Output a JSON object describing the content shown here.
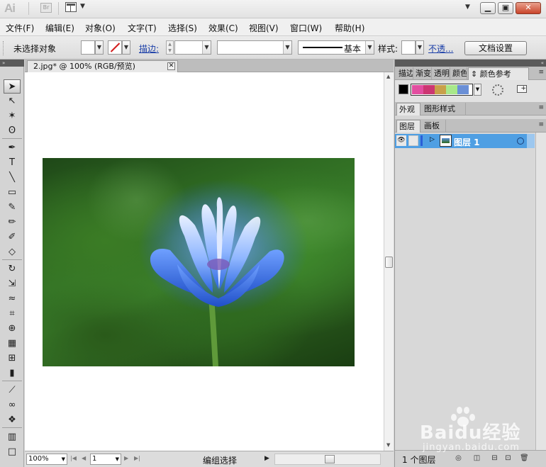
{
  "app": {
    "logo": "Ai",
    "bridge": "Br"
  },
  "colors": {
    "layer_highlight": "#4f9fe3",
    "color_guide_swatches": [
      "#e24ea0",
      "#cc3672",
      "#c8a04a",
      "#a8e88a",
      "#6a8fd6"
    ]
  },
  "menu": [
    "文件(F)",
    "编辑(E)",
    "对象(O)",
    "文字(T)",
    "选择(S)",
    "效果(C)",
    "视图(V)",
    "窗口(W)",
    "帮助(H)"
  ],
  "control_bar": {
    "selection_status": "未选择对象",
    "stroke_label": "描边:",
    "brush_label": "基本",
    "style_label": "样式:",
    "opacity_label": "不透...",
    "doc_setup_button": "文档设置"
  },
  "document": {
    "tab_title": "2.jpg* @ 100% (RGB/预览)",
    "close_icon": "close-icon"
  },
  "tools": [
    {
      "name": "selection-tool-icon",
      "glyph": "➤",
      "active": true
    },
    {
      "name": "direct-selection-tool-icon",
      "glyph": "↖"
    },
    {
      "name": "magic-wand-tool-icon",
      "glyph": "✶"
    },
    {
      "name": "lasso-tool-icon",
      "glyph": "ʘ"
    },
    {
      "name": "pen-tool-icon",
      "glyph": "✒"
    },
    {
      "name": "type-tool-icon",
      "glyph": "T"
    },
    {
      "name": "line-tool-icon",
      "glyph": "╲"
    },
    {
      "name": "rectangle-tool-icon",
      "glyph": "▭"
    },
    {
      "name": "paintbrush-tool-icon",
      "glyph": "✎"
    },
    {
      "name": "pencil-tool-icon",
      "glyph": "✏"
    },
    {
      "name": "blob-brush-tool-icon",
      "glyph": "✐"
    },
    {
      "name": "eraser-tool-icon",
      "glyph": "◇"
    },
    {
      "name": "rotate-tool-icon",
      "glyph": "↻"
    },
    {
      "name": "scale-tool-icon",
      "glyph": "⇲"
    },
    {
      "name": "warp-tool-icon",
      "glyph": "≈"
    },
    {
      "name": "free-transform-tool-icon",
      "glyph": "⌗"
    },
    {
      "name": "shape-builder-tool-icon",
      "glyph": "⊕"
    },
    {
      "name": "perspective-grid-tool-icon",
      "glyph": "▦"
    },
    {
      "name": "mesh-tool-icon",
      "glyph": "⊞"
    },
    {
      "name": "gradient-tool-icon",
      "glyph": "▮"
    },
    {
      "name": "eyedropper-tool-icon",
      "glyph": "⟋"
    },
    {
      "name": "blend-tool-icon",
      "glyph": "∞"
    },
    {
      "name": "symbol-sprayer-tool-icon",
      "glyph": "❖"
    },
    {
      "name": "column-graph-tool-icon",
      "glyph": "▥"
    },
    {
      "name": "artboard-tool-icon",
      "glyph": "□"
    }
  ],
  "panels": {
    "group1_tabs": [
      "描边",
      "渐变",
      "透明",
      "颜色",
      "颜色参考"
    ],
    "group2_tabs": [
      "外观",
      "图形样式"
    ],
    "group3_tabs": [
      "图层",
      "画板"
    ],
    "layer_name": "图层 1",
    "layer_count": "1 个图层"
  },
  "status_bar": {
    "zoom": "100%",
    "page": "1",
    "status": "编组选择"
  },
  "watermark": {
    "brand": "Baidu经验",
    "url": "jingyan.baidu.com"
  }
}
